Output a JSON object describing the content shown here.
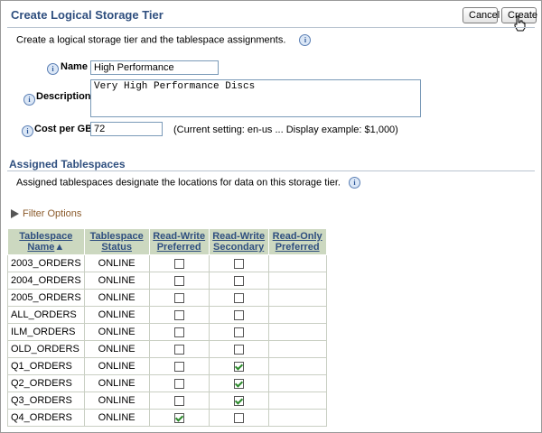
{
  "header": {
    "title": "Create Logical Storage Tier",
    "cancel_label": "Cancel",
    "create_label": "Create"
  },
  "instruction": "Create a logical storage tier and the tablespace assignments.",
  "form": {
    "name_label": "Name",
    "name_value": "High Performance",
    "description_label": "Description",
    "description_value": "Very High Performance Discs",
    "cost_label": "Cost per GB",
    "cost_value": "72",
    "cost_hint": "(Current setting: en-us ... Display example: $1,000)"
  },
  "assigned": {
    "title": "Assigned Tablespaces",
    "description": "Assigned tablespaces designate the locations for data on this storage tier.",
    "filter_label": "Filter Options"
  },
  "table": {
    "headers": {
      "name": "Tablespace Name",
      "status": "Tablespace Status",
      "rw_pref": "Read-Write Preferred",
      "rw_sec": "Read-Write Secondary",
      "ro_pref": "Read-Only Preferred"
    },
    "sort_indicator": "▲",
    "rows": [
      {
        "name": "2003_ORDERS",
        "status": "ONLINE",
        "rw_pref": false,
        "rw_sec": false
      },
      {
        "name": "2004_ORDERS",
        "status": "ONLINE",
        "rw_pref": false,
        "rw_sec": false
      },
      {
        "name": "2005_ORDERS",
        "status": "ONLINE",
        "rw_pref": false,
        "rw_sec": false
      },
      {
        "name": "ALL_ORDERS",
        "status": "ONLINE",
        "rw_pref": false,
        "rw_sec": false
      },
      {
        "name": "ILM_ORDERS",
        "status": "ONLINE",
        "rw_pref": false,
        "rw_sec": false
      },
      {
        "name": "OLD_ORDERS",
        "status": "ONLINE",
        "rw_pref": false,
        "rw_sec": false
      },
      {
        "name": "Q1_ORDERS",
        "status": "ONLINE",
        "rw_pref": false,
        "rw_sec": true
      },
      {
        "name": "Q2_ORDERS",
        "status": "ONLINE",
        "rw_pref": false,
        "rw_sec": true
      },
      {
        "name": "Q3_ORDERS",
        "status": "ONLINE",
        "rw_pref": false,
        "rw_sec": true
      },
      {
        "name": "Q4_ORDERS",
        "status": "ONLINE",
        "rw_pref": true,
        "rw_sec": false
      }
    ]
  },
  "colors": {
    "title": "#2f4f7f",
    "table_header_bg": "#ccd8c0",
    "check": "#2c8a2c",
    "filter_link": "#8a5a2a"
  },
  "icons": [
    "info-icon",
    "filter-triangle-icon",
    "sort-ascending-icon",
    "hand-cursor-icon"
  ]
}
